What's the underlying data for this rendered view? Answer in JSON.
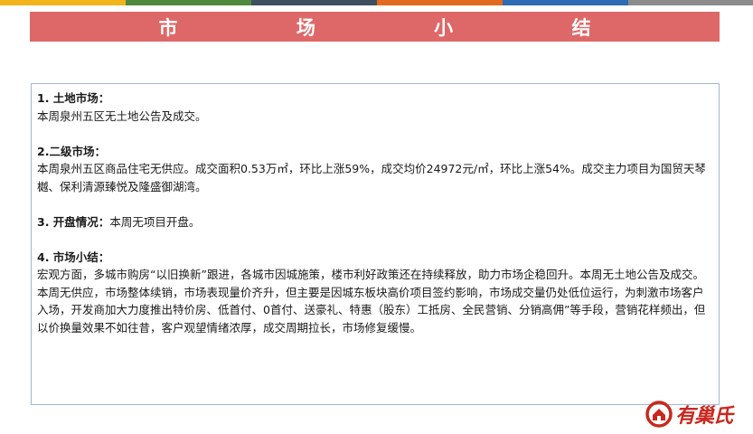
{
  "colors": {
    "top_bar": [
      "#f3b31b",
      "#4e8a3c",
      "#3e4f5f",
      "#e16a1f",
      "#2f6bb4",
      "#8c8c8c"
    ],
    "banner": "#de6868",
    "box_border": "#9fb7d6",
    "logo": "#c8281e"
  },
  "header": {
    "title": "市 场 小 结"
  },
  "sections": [
    {
      "heading": "1. 土地市场：",
      "body": "本周泉州五区无土地公告及成交。"
    },
    {
      "heading": "2.二级市场：",
      "body": "本周泉州五区商品住宅无供应。成交面积0.53万㎡，环比上涨59%，成交均价24972元/㎡，环比上涨54%。成交主力项目为国贸天琴樾、保利清源臻悦及隆盛御湖湾。"
    },
    {
      "heading": "3. 开盘情况：",
      "body": "本周无项目开盘。"
    },
    {
      "heading": "4. 市场小结：",
      "body": "宏观方面，多城市购房“以旧换新”跟进，各城市因城施策，楼市利好政策还在持续释放，助力市场企稳回升。本周无土地公告及成交。本周无供应，市场整体续销，市场表现量价齐升，但主要是因城东板块高价项目签约影响，市场成交量仍处低位运行，为刺激市场客户入场，开发商加大力度推出特价房、低首付、0首付、送豪礼、特惠（股东）工抵房、全民营销、分销高佣”等手段，营销花样频出，但以价换量效果不如往昔，客户观望情绪浓厚，成交周期拉长，市场修复缓慢。"
    }
  ],
  "logo": {
    "text": "有巢氏",
    "icon": "house-circle-logo-icon"
  }
}
